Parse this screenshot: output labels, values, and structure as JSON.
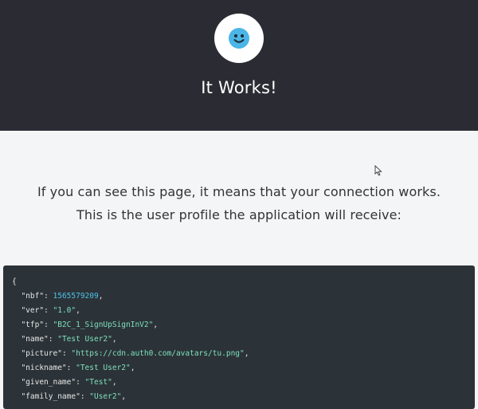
{
  "header": {
    "avatar_icon": "smiley-face-icon",
    "title": "It Works!",
    "accent_color": "#4ab5e6"
  },
  "message": {
    "line1": "If you can see this page, it means that your connection works.",
    "line2": "This is the user profile the application will receive:"
  },
  "profile": {
    "open_brace": "{",
    "fields": [
      {
        "key": "\"nbf\"",
        "value": "1565579209",
        "type": "number"
      },
      {
        "key": "\"ver\"",
        "value": "\"1.0\"",
        "type": "string"
      },
      {
        "key": "\"tfp\"",
        "value": "\"B2C_1_SignUpSignInV2\"",
        "type": "string"
      },
      {
        "key": "\"name\"",
        "value": "\"Test User2\"",
        "type": "string"
      },
      {
        "key": "\"picture\"",
        "value": "\"https://cdn.auth0.com/avatars/tu.png\"",
        "type": "string"
      },
      {
        "key": "\"nickname\"",
        "value": "\"Test User2\"",
        "type": "string"
      },
      {
        "key": "\"given_name\"",
        "value": "\"Test\"",
        "type": "string"
      },
      {
        "key": "\"family_name\"",
        "value": "\"User2\"",
        "type": "string"
      }
    ]
  },
  "cursor_icon": "mouse-pointer-icon"
}
